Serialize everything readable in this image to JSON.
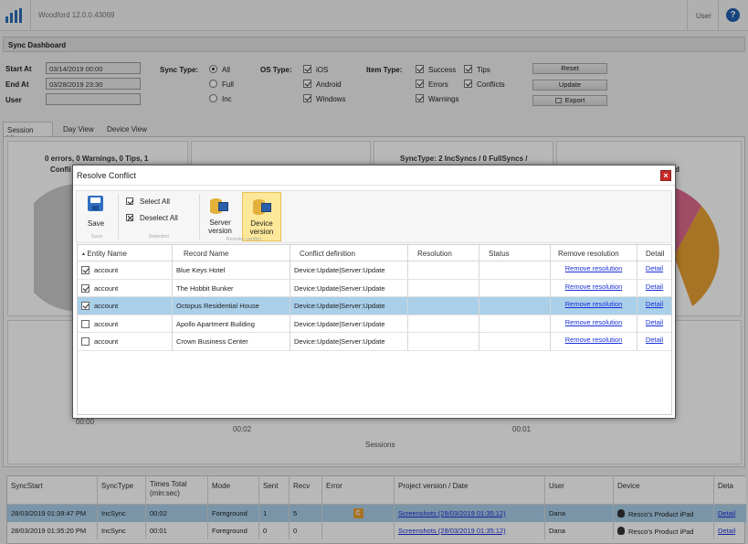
{
  "app": {
    "title": "Woodford 12.0.0.43069",
    "user_label": "User",
    "help": "?"
  },
  "dashboard": {
    "title": "Sync Dashboard"
  },
  "filters": {
    "start_label": "Start At",
    "start_value": "03/14/2019 00:00",
    "end_label": "End At",
    "end_value": "03/28/2019 23:30",
    "user_label": "User",
    "user_value": "",
    "sync_type_label": "Sync Type:",
    "sync_types": [
      "All",
      "Full",
      "Inc"
    ],
    "os_type_label": "OS Type:",
    "os_types": [
      "iOS",
      "Android",
      "Windows"
    ],
    "item_type_label": "Item Type:",
    "item_types": [
      "Success",
      "Errors",
      "Warnings",
      "Tips",
      "Conflicts"
    ],
    "reset": "Reset",
    "update": "Update",
    "export": "Export"
  },
  "tabs": [
    "Session View",
    "Day View",
    "Device View"
  ],
  "panels": {
    "summary1_line1": "0 errors, 0 Warnings, 0 Tips, 1",
    "summary1_line2": "Confli",
    "summary3": "SyncType: 2 IncSyncs / 0 FullSyncs /",
    "summary4_frag": "d",
    "axis_y0": "00:00",
    "axis_x1": "00:02",
    "axis_x2": "00:01",
    "sessions": "Sessions"
  },
  "grid": {
    "headers": [
      "SyncStart",
      "SyncType",
      "Times Total (min:sec)",
      "Mode",
      "Sent",
      "Recv",
      "Error",
      "Project version / Date",
      "User",
      "Device",
      "Deta"
    ],
    "rows": [
      {
        "start": "28/03/2019 01:39:47 PM",
        "type": "IncSync",
        "time": "00:02",
        "mode": "Foreground",
        "sent": "1",
        "recv": "5",
        "error": "C",
        "project": "Screenshots (28/03/2019 01:35:12)",
        "user": "Dana",
        "device": "Resco's Product iPad",
        "detail": "Detail"
      },
      {
        "start": "28/03/2019 01:35:20 PM",
        "type": "IncSync",
        "time": "00:01",
        "mode": "Foreground",
        "sent": "0",
        "recv": "0",
        "error": "",
        "project": "Screenshots (28/03/2019 01:35:12)",
        "user": "Dana",
        "device": "Resco's Product iPad",
        "detail": "Detail"
      }
    ]
  },
  "dialog": {
    "title": "Resolve Conflict",
    "close": "×",
    "ribbon": {
      "save": "Save",
      "save_group": "Save",
      "select_all": "Select All",
      "deselect_all": "Deselect All",
      "selection_group": "Selection",
      "server_version_1": "Server",
      "server_version_2": "version",
      "device_version_1": "Device",
      "device_version_2": "version",
      "resolve_group": "Resolve conflict"
    },
    "headers": [
      "Entity Name",
      "Record Name",
      "Conflict definition",
      "Resolution",
      "Status",
      "Remove resolution",
      "Detail"
    ],
    "rows": [
      {
        "checked": true,
        "entity": "account",
        "record": "Blue Keys Hotel",
        "conflict": "Device:Update|Server:Update",
        "resolution": "",
        "status": "",
        "remove": "Remove resolution",
        "detail": "Detail"
      },
      {
        "checked": true,
        "entity": "account",
        "record": "The Hobbit Bunker",
        "conflict": "Device:Update|Server:Update",
        "resolution": "",
        "status": "",
        "remove": "Remove resolution",
        "detail": "Detail"
      },
      {
        "checked": true,
        "entity": "account",
        "record": "Octopus Residential House",
        "conflict": "Device:Update|Server:Update",
        "resolution": "",
        "status": "",
        "remove": "Remove resolution",
        "detail": "Detail"
      },
      {
        "checked": false,
        "entity": "account",
        "record": "Apollo Apartment Building",
        "conflict": "Device:Update|Server:Update",
        "resolution": "",
        "status": "",
        "remove": "Remove resolution",
        "detail": "Detail"
      },
      {
        "checked": false,
        "entity": "account",
        "record": "Crown Business Center",
        "conflict": "Device:Update|Server:Update",
        "resolution": "",
        "status": "",
        "remove": "Remove resolution",
        "detail": "Detail"
      }
    ]
  },
  "colors": {
    "accent": "#2d6db5",
    "selected_row": "#a9cfe9",
    "pie_pink": "#e06a8f",
    "pie_orange": "#e8a033",
    "pie_grey": "#c9c9c9"
  }
}
